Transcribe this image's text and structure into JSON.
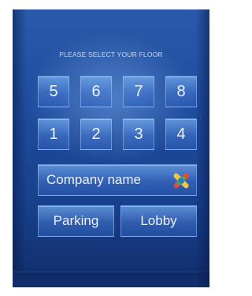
{
  "prompt": "PLEASE SELECT YOUR FLOOR",
  "row_top": [
    "5",
    "6",
    "7",
    "8"
  ],
  "row_bottom": [
    "1",
    "2",
    "3",
    "4"
  ],
  "company_button": "Company name",
  "parking_button": "Parking",
  "lobby_button": "Lobby",
  "colors": {
    "panel_blue": "#1f4d9e",
    "key_blue": "#5a8fd8",
    "text": "#f5faff"
  },
  "icons": {
    "company_logo": "colorful-x-logo-icon"
  }
}
